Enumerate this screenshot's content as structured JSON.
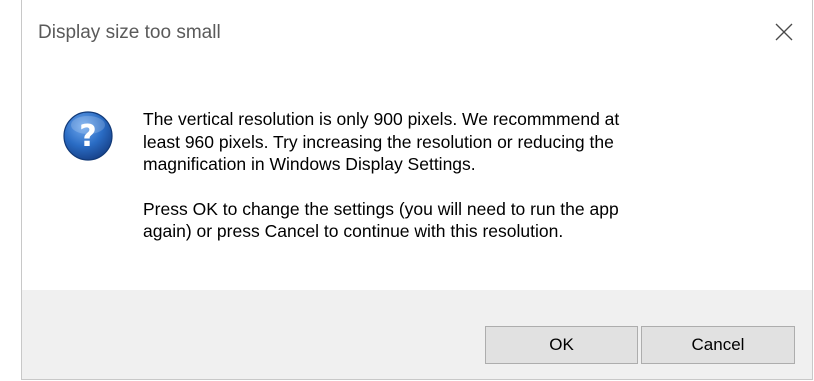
{
  "dialog": {
    "title": "Display size too small",
    "close_icon": "close-icon",
    "icon": "question-icon",
    "message_paragraph_1": "The vertical resolution is only 900 pixels.  We recommmend at\nleast 960 pixels.  Try increasing the resolution or reducing the\nmagnification in Windows Display Settings.",
    "message_paragraph_2": "Press OK to change the settings (you will need to run the app\nagain) or press Cancel to continue with this resolution.",
    "ok_label": "OK",
    "cancel_label": "Cancel"
  },
  "colors": {
    "icon_blue": "#1f5fb4",
    "footer_bg": "#f0f0f0",
    "button_bg": "#e1e1e1",
    "title_text": "#5a5a5a"
  }
}
